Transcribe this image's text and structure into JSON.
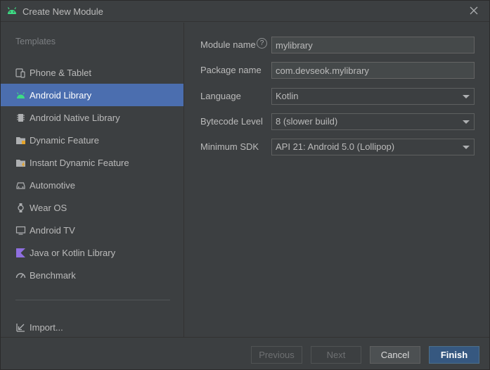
{
  "window": {
    "title": "Create New Module"
  },
  "sidebar": {
    "heading": "Templates",
    "items": [
      {
        "label": "Phone & Tablet",
        "icon": "phone-tablet-icon"
      },
      {
        "label": "Android Library",
        "icon": "android-icon",
        "selected": true
      },
      {
        "label": "Android Native Library",
        "icon": "chip-icon"
      },
      {
        "label": "Dynamic Feature",
        "icon": "folder-feature-icon"
      },
      {
        "label": "Instant Dynamic Feature",
        "icon": "folder-lightning-icon"
      },
      {
        "label": "Automotive",
        "icon": "car-icon"
      },
      {
        "label": "Wear OS",
        "icon": "watch-icon"
      },
      {
        "label": "Android TV",
        "icon": "tv-icon"
      },
      {
        "label": "Java or Kotlin Library",
        "icon": "kotlin-icon"
      },
      {
        "label": "Benchmark",
        "icon": "gauge-icon"
      }
    ],
    "import_label": "Import..."
  },
  "form": {
    "module_name": {
      "label": "Module name",
      "value": "mylibrary",
      "help": "?"
    },
    "package_name": {
      "label": "Package name",
      "value": "com.devseok.mylibrary"
    },
    "language": {
      "label": "Language",
      "value": "Kotlin"
    },
    "bytecode_level": {
      "label": "Bytecode Level",
      "value": "8 (slower build)"
    },
    "minimum_sdk": {
      "label": "Minimum SDK",
      "value": "API 21: Android 5.0 (Lollipop)"
    }
  },
  "footer": {
    "previous": "Previous",
    "next": "Next",
    "cancel": "Cancel",
    "finish": "Finish"
  },
  "colors": {
    "background": "#3c3f41",
    "selection": "#4b6eaf",
    "primary_button": "#365880",
    "android_green": "#3ddc84",
    "kotlin_purple": "#8f6fe0"
  }
}
